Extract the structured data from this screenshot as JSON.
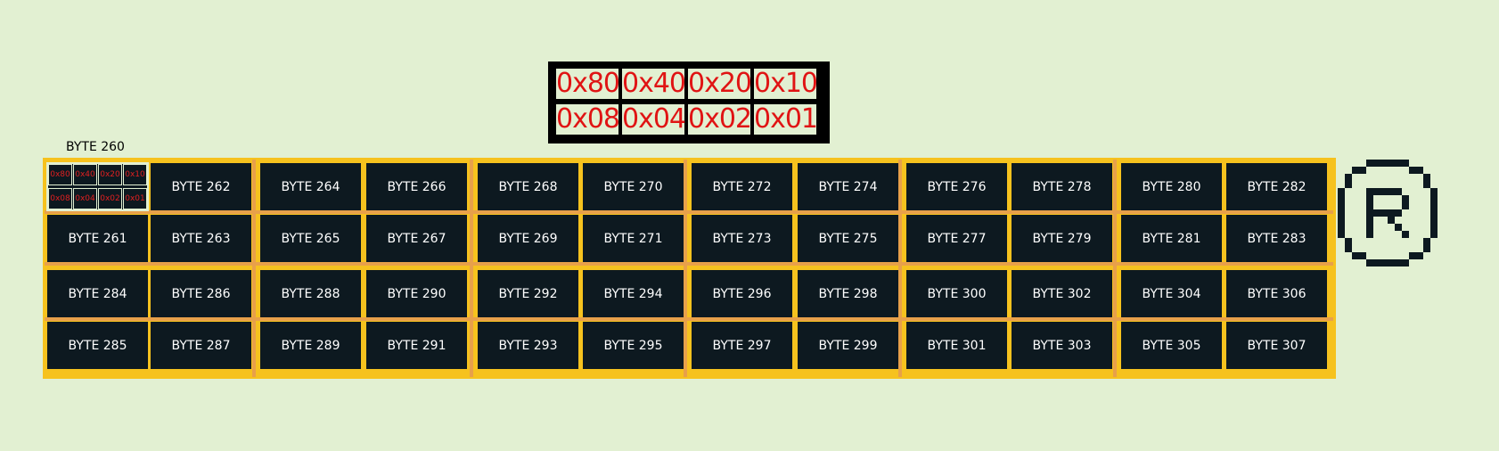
{
  "legend": {
    "bits": [
      "0x80",
      "0x40",
      "0x20",
      "0x10",
      "0x08",
      "0x04",
      "0x02",
      "0x01"
    ]
  },
  "grid": {
    "top_label": "BYTE 260",
    "first_cell_bits": [
      "0x80",
      "0x40",
      "0x20",
      "0x10",
      "0x08",
      "0x04",
      "0x02",
      "0x01"
    ],
    "rows": [
      [
        "",
        "BYTE 262",
        "BYTE 264",
        "BYTE 266",
        "BYTE 268",
        "BYTE 270",
        "BYTE 272",
        "BYTE 274",
        "BYTE 276",
        "BYTE 278",
        "BYTE 280",
        "BYTE 282"
      ],
      [
        "BYTE 261",
        "BYTE 263",
        "BYTE 265",
        "BYTE 267",
        "BYTE 269",
        "BYTE 271",
        "BYTE 273",
        "BYTE 275",
        "BYTE 277",
        "BYTE 279",
        "BYTE 281",
        "BYTE 283"
      ],
      [
        "BYTE 284",
        "BYTE 286",
        "BYTE 288",
        "BYTE 290",
        "BYTE 292",
        "BYTE 294",
        "BYTE 296",
        "BYTE 298",
        "BYTE 300",
        "BYTE 302",
        "BYTE 304",
        "BYTE 306"
      ],
      [
        "BYTE 285",
        "BYTE 287",
        "BYTE 289",
        "BYTE 291",
        "BYTE 293",
        "BYTE 295",
        "BYTE 297",
        "BYTE 299",
        "BYTE 301",
        "BYTE 303",
        "BYTE 305",
        "BYTE 307"
      ]
    ]
  },
  "logo": {
    "icon": "registered-r-icon"
  },
  "colors": {
    "background": "#e2f0d2",
    "cell": "#0d1920",
    "frame": "#f6c21e",
    "divider": "#e8a04a",
    "bit_text": "#e01414"
  }
}
